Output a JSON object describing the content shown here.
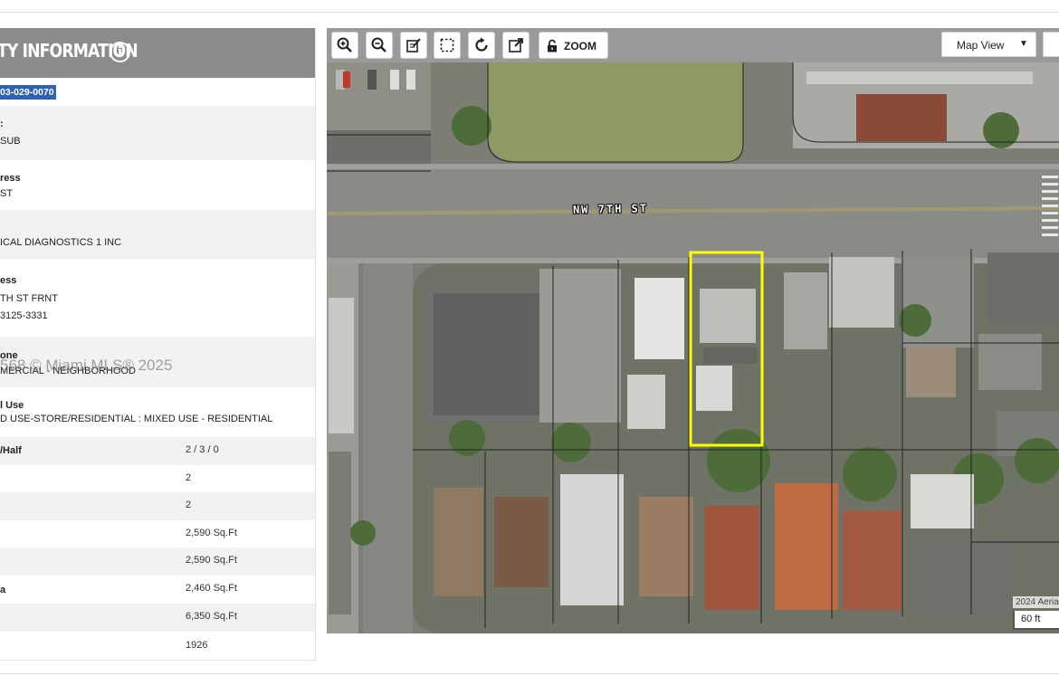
{
  "panel": {
    "title": "TY INFORMATION",
    "folio": "03-029-0070",
    "fields": [
      {
        "label": ":",
        "value": " SUB"
      },
      {
        "label": "ress",
        "value": "ST"
      },
      {
        "label": "",
        "value": "ICAL DIAGNOSTICS 1 INC"
      },
      {
        "label": "ess",
        "value": "TH ST FRNT",
        "value2": "3125-3331"
      },
      {
        "label": "one",
        "value": "MERCIAL - NEIGHBORHOOD"
      },
      {
        "label": "l Use",
        "value": "D USE-STORE/RESIDENTIAL : MIXED USE - RESIDENTIAL"
      }
    ],
    "stats": [
      {
        "label": "/Half",
        "value": "2 / 3 / 0"
      },
      {
        "label": "",
        "value": "2"
      },
      {
        "label": "",
        "value": "2"
      },
      {
        "label": "",
        "value": "2,590 Sq.Ft"
      },
      {
        "label": "",
        "value": "2,590 Sq.Ft"
      },
      {
        "label": "a",
        "value": "2,460 Sq.Ft"
      },
      {
        "label": "",
        "value": "6,350 Sq.Ft"
      },
      {
        "label": "",
        "value": "1926"
      }
    ],
    "watermark": "568 © Miami MLS® 2025"
  },
  "map": {
    "zoom_label": "ZOOM",
    "map_view_label": "Map View",
    "street_label": "NW 7TH ST",
    "year_label": "2024 Aeria",
    "scale_label": "60 ft",
    "highlight_color": "#ffff00"
  }
}
